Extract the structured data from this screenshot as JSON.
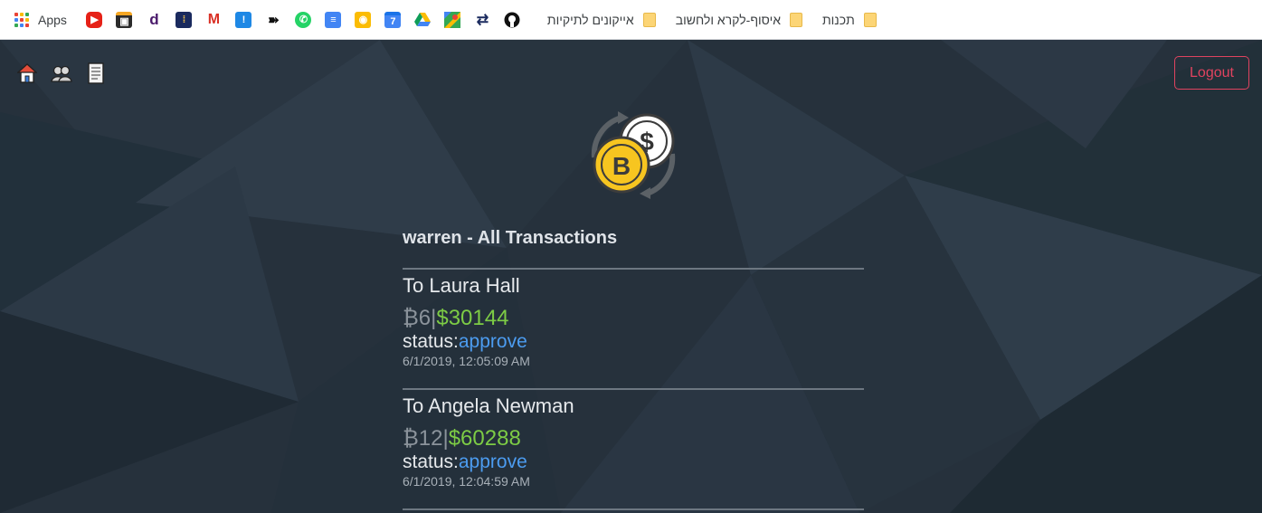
{
  "bookmarks": {
    "apps_label": "Apps",
    "icons": [
      {
        "name": "youtube-icon",
        "color": "#e62117",
        "glyph": "▶"
      },
      {
        "name": "shopping-bag-icon",
        "color": "#3b3b3b",
        "glyph": "▣"
      },
      {
        "name": "d-app-icon",
        "color": "#4a1a6b",
        "glyph": "d"
      },
      {
        "name": "bookmark-app-icon",
        "color": "#1a2a5e",
        "glyph": "⁞"
      },
      {
        "name": "gmail-icon",
        "color": "#ffffff",
        "glyph": "M"
      },
      {
        "name": "exclamation-app-icon",
        "color": "#1e88e5",
        "glyph": "!"
      },
      {
        "name": "moovit-icon",
        "color": "#ffffff",
        "glyph": "➽"
      },
      {
        "name": "whatsapp-icon",
        "color": "#25d366",
        "glyph": "✆"
      },
      {
        "name": "google-docs-icon",
        "color": "#4285f4",
        "glyph": "≡"
      },
      {
        "name": "google-keep-icon",
        "color": "#fbbc04",
        "glyph": "◉"
      },
      {
        "name": "google-calendar-icon",
        "color": "#4285f4",
        "glyph": "7"
      },
      {
        "name": "google-drive-icon",
        "color": "#ffffff",
        "glyph": "▲"
      },
      {
        "name": "google-maps-icon",
        "color": "#34a853",
        "glyph": "◆"
      },
      {
        "name": "israel-rail-icon",
        "color": "#ffffff",
        "glyph": "⇄"
      },
      {
        "name": "github-icon",
        "color": "#ffffff",
        "glyph": "●"
      }
    ],
    "folders": [
      "אייקונים לתיקיות",
      "איסוף-לקרא ולחשוב",
      "תכנות"
    ]
  },
  "nav": {
    "icons": [
      "home-icon",
      "users-icon",
      "ledger-icon"
    ]
  },
  "header": {
    "logout_label": "Logout"
  },
  "logo": {
    "name": "currency-exchange-logo"
  },
  "main": {
    "title": "warren - All Transactions",
    "status_label": "status:",
    "transactions": [
      {
        "to": "To Laura Hall",
        "btc": "₿6",
        "separator": "|",
        "usd": "$30144",
        "status": "approve",
        "timestamp": "6/1/2019, 12:05:09 AM"
      },
      {
        "to": "To Angela Newman",
        "btc": "₿12",
        "separator": "|",
        "usd": "$60288",
        "status": "approve",
        "timestamp": "6/1/2019, 12:04:59 AM"
      }
    ]
  },
  "colors": {
    "page_bg": "#26313c",
    "logout_accent": "#e0435f",
    "usd_green": "#7dcc45",
    "status_blue": "#4c9cf0",
    "btc_grey": "#8b939b"
  }
}
